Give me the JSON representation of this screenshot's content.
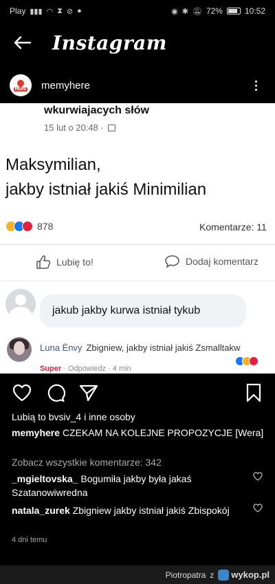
{
  "statusbar": {
    "carrier": "Play",
    "battery": "72%",
    "time": "10:52"
  },
  "appbar": {
    "title": "Instagram"
  },
  "post": {
    "username": "memyhere",
    "avatar_text": "HERE"
  },
  "photo": {
    "headline": "wkurwiajacych słów",
    "date": "15 lut o 20:48 ·",
    "text_line1": "Maksymilian,",
    "text_line2": "jakby istniał jakiś Minimilian",
    "reaction_count": "878",
    "comments_count": "Komentarze: 11",
    "like_label": "Lubię to!",
    "comment_label": "Dodaj komentarz",
    "comment1": "jakub jakby kurwa istniał tykub",
    "comment2_name": "Luna Ënvy",
    "comment2_text": "Zbigniew, jakby istniał jakiś Zsmalltakw",
    "comment2_meta_red": "Super",
    "comment2_meta": " · Odpowiedz · 4 min"
  },
  "likes_text": "Lubią to bvsiv_4 i inne osoby",
  "caption": {
    "user": "memyhere",
    "text": "CZEKAM NA KOLEJNE PROPOZYCJE [Wera]"
  },
  "view_all": "Zobacz wszystkie komentarze: 342",
  "comments": [
    {
      "user": "_mgieltovska_",
      "text": "Bogumiła jakby była jakaś Szatanowiwredna"
    },
    {
      "user": "natala_zurek",
      "text": "Zbigniew jakby istniał jakiś Zbispokój"
    }
  ],
  "time_ago": "4 dni temu",
  "watermark": {
    "author": "Piotropatra",
    "via": "z",
    "site": "wykop.pl"
  },
  "icons": [
    "back-arrow-icon",
    "kebab-menu-icon",
    "heart-icon",
    "comment-icon",
    "share-icon",
    "bookmark-icon"
  ]
}
